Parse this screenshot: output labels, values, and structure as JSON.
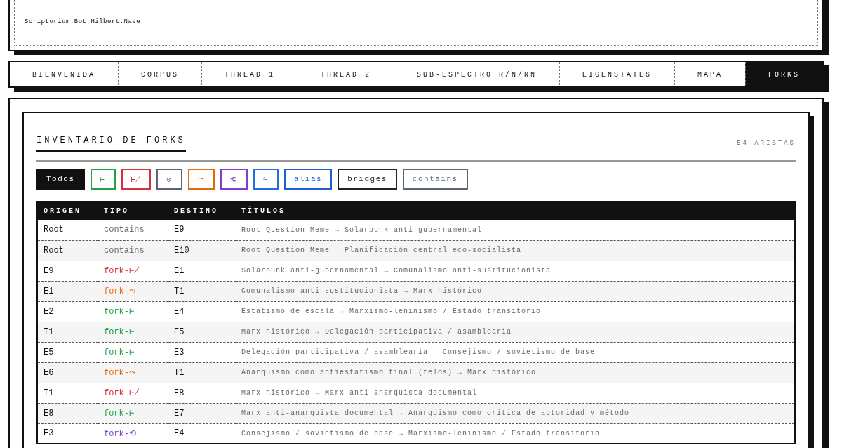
{
  "header": {
    "title": "Scriptorium.Bot Hilbert.Nave"
  },
  "tabs": [
    {
      "label": "BIENVENIDA",
      "selected": false
    },
    {
      "label": "CORPUS",
      "selected": false
    },
    {
      "label": "THREAD 1",
      "selected": false
    },
    {
      "label": "THREAD 2",
      "selected": false
    },
    {
      "label": "SUB-ESPECTRO R/N/RN",
      "selected": false
    },
    {
      "label": "EIGENSTATES",
      "selected": false
    },
    {
      "label": "MAPA",
      "selected": false
    },
    {
      "label": "FORKS",
      "selected": true
    }
  ],
  "panel": {
    "title": "INVENTARIO DE FORKS",
    "count": "54 ARISTAS",
    "filters": [
      {
        "label": "Todos",
        "selected": true,
        "color": "#111111"
      },
      {
        "label": "⊢",
        "selected": false,
        "color": "#22a045"
      },
      {
        "label": "⊬",
        "selected": false,
        "color": "#d6303f"
      },
      {
        "label": "⊘",
        "selected": false,
        "color": "#5c6670"
      },
      {
        "label": "⤳",
        "selected": false,
        "color": "#e8690c"
      },
      {
        "label": "⟲",
        "selected": false,
        "color": "#7c3fd0"
      },
      {
        "label": "≈",
        "selected": false,
        "color": "#1f6fe0"
      },
      {
        "label": "alias",
        "selected": false,
        "color": "#1a62d0"
      },
      {
        "label": "bridges",
        "selected": false,
        "color": "#222222"
      },
      {
        "label": "contains",
        "selected": false,
        "color": "#5c6670"
      }
    ],
    "table": {
      "columns": [
        "ORIGEN",
        "TIPO",
        "DESTINO",
        "TÍTULOS"
      ],
      "rows": [
        {
          "origin": "Root",
          "type": "contains",
          "color": "#6b6b6b",
          "target": "E9",
          "titles": "Root Question Meme → Solarpunk anti-gubernamental"
        },
        {
          "origin": "Root",
          "type": "contains",
          "color": "#6b6b6b",
          "target": "E10",
          "titles": "Root Question Meme → Planificación central eco-socialista"
        },
        {
          "origin": "E9",
          "type": "fork-⊬",
          "color": "#d6303f",
          "target": "E1",
          "titles": "Solarpunk anti-gubernamental → Comunalismo anti-sustitucionista"
        },
        {
          "origin": "E1",
          "type": "fork-⤳",
          "color": "#e8690c",
          "target": "T1",
          "titles": "Comunalismo anti-sustitucionista → Marx histórico"
        },
        {
          "origin": "E2",
          "type": "fork-⊢",
          "color": "#22a045",
          "target": "E4",
          "titles": "Estatismo de escala → Marxismo-leninismo / Estado transitorio"
        },
        {
          "origin": "T1",
          "type": "fork-⊢",
          "color": "#22a045",
          "target": "E5",
          "titles": "Marx histórico → Delegación participativa / asamblearia"
        },
        {
          "origin": "E5",
          "type": "fork-⊢",
          "color": "#22a045",
          "target": "E3",
          "titles": "Delegación participativa / asamblearia → Consejismo / sovietismo de base"
        },
        {
          "origin": "E6",
          "type": "fork-⤳",
          "color": "#e8690c",
          "target": "T1",
          "titles": "Anarquismo como antiestatismo final (telos) → Marx histórico"
        },
        {
          "origin": "T1",
          "type": "fork-⊬",
          "color": "#d6303f",
          "target": "E8",
          "titles": "Marx histórico → Marx anti-anarquista documental"
        },
        {
          "origin": "E8",
          "type": "fork-⊢",
          "color": "#22a045",
          "target": "E7",
          "titles": "Marx anti-anarquista documental → Anarquismo como crítica de autoridad y método"
        },
        {
          "origin": "E3",
          "type": "fork-⟲",
          "color": "#7c3fd0",
          "target": "E4",
          "titles": "Consejismo / sovietismo de base → Marxismo-leninismo / Estado transitorio"
        }
      ]
    }
  }
}
